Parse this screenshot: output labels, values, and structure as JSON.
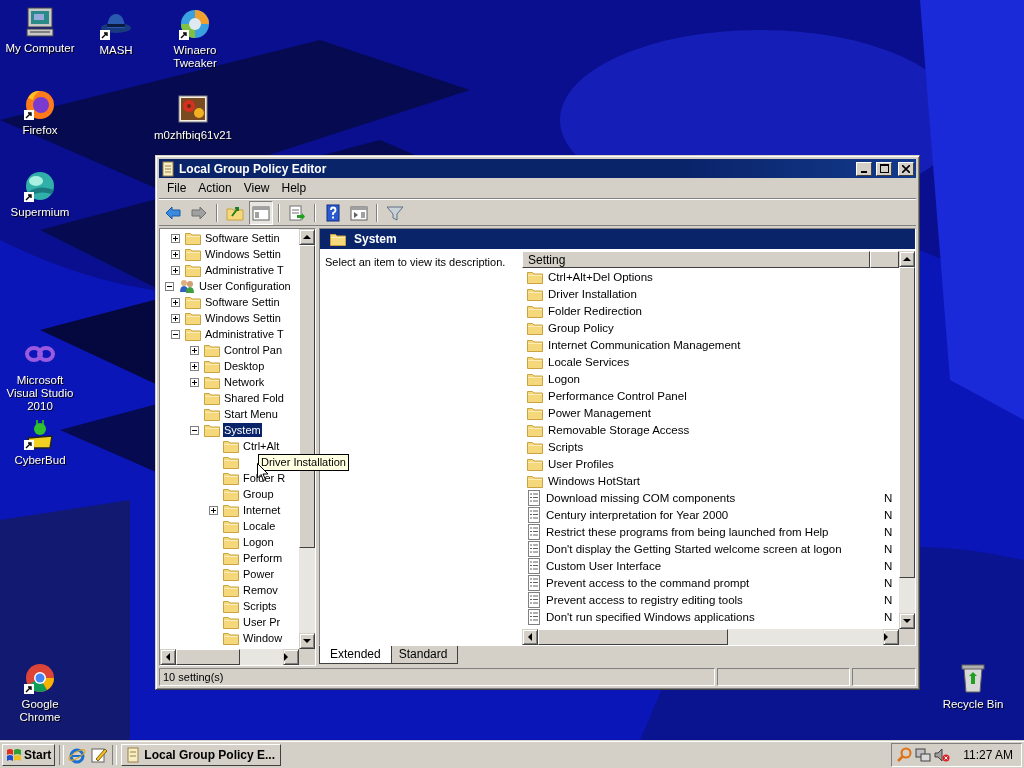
{
  "desktop_icons": [
    {
      "label": "My Computer",
      "shortcut": false
    },
    {
      "label": "MASH",
      "shortcut": true
    },
    {
      "label": "Winaero Tweaker",
      "shortcut": true
    },
    {
      "label": "Firefox",
      "shortcut": true
    },
    {
      "label": "m0zhfbiq61v21",
      "shortcut": false
    },
    {
      "label": "Supermium",
      "shortcut": true
    },
    {
      "label": "Microsoft Visual Studio 2010",
      "shortcut": false
    },
    {
      "label": "CyberBud",
      "shortcut": true
    },
    {
      "label": "Google Chrome",
      "shortcut": true
    },
    {
      "label": "Recycle Bin",
      "shortcut": false
    }
  ],
  "window": {
    "title": "Local Group Policy Editor",
    "menu": [
      "File",
      "Action",
      "View",
      "Help"
    ],
    "toolbar": [
      {
        "pressed": false
      },
      {
        "pressed": false
      },
      {
        "pressed": false
      },
      {
        "pressed": true
      },
      {
        "pressed": false
      },
      {
        "pressed": false
      },
      {
        "pressed": false
      },
      {
        "pressed": false
      }
    ],
    "tree": [
      {
        "children": [
          {
            "label": "Software Settin",
            "kind": "folder",
            "expanded": false,
            "selected": false
          },
          {
            "label": "Windows Settin",
            "kind": "folder",
            "expanded": false,
            "selected": false
          },
          {
            "label": "Administrative T",
            "kind": "folder",
            "expanded": false,
            "selected": false
          }
        ]
      },
      {
        "label": "User Configuration",
        "kind": "user",
        "expanded": true,
        "selected": false,
        "children": [
          {
            "label": "Software Settin",
            "kind": "folder",
            "expanded": false,
            "selected": false
          },
          {
            "label": "Windows Settin",
            "kind": "folder",
            "expanded": false,
            "selected": false
          },
          {
            "label": "Administrative T",
            "kind": "folder",
            "expanded": true,
            "selected": false,
            "children": [
              {
                "label": "Control Pan",
                "kind": "folder",
                "expanded": false,
                "selected": false
              },
              {
                "label": "Desktop",
                "kind": "folder",
                "expanded": false,
                "selected": false
              },
              {
                "label": "Network",
                "kind": "folder",
                "expanded": false,
                "selected": false
              },
              {
                "label": "Shared Fold",
                "kind": "folder",
                "selected": false
              },
              {
                "label": "Start Menu",
                "kind": "folder",
                "selected": false
              },
              {
                "label": "System",
                "kind": "folder",
                "expanded": true,
                "selected": true,
                "children": [
                  {
                    "label": "Ctrl+Alt",
                    "kind": "folder",
                    "selected": false
                  },
                  {
                    "kind": "folder",
                    "selected": false
                  },
                  {
                    "label": "Folder R",
                    "kind": "folder",
                    "selected": false
                  },
                  {
                    "label": "Group",
                    "kind": "folder",
                    "selected": false
                  },
                  {
                    "label": "Internet",
                    "kind": "folder",
                    "expanded": false,
                    "selected": false
                  },
                  {
                    "label": "Locale",
                    "kind": "folder",
                    "selected": false
                  },
                  {
                    "label": "Logon",
                    "kind": "folder",
                    "selected": false
                  },
                  {
                    "label": "Perform",
                    "kind": "folder",
                    "selected": false
                  },
                  {
                    "label": "Power",
                    "kind": "folder",
                    "selected": false
                  },
                  {
                    "label": "Remov",
                    "kind": "folder",
                    "selected": false
                  },
                  {
                    "label": "Scripts",
                    "kind": "folder",
                    "selected": false
                  },
                  {
                    "label": "User Pr",
                    "kind": "folder",
                    "selected": false
                  },
                  {
                    "label": "Window",
                    "kind": "folder",
                    "selected": false
                  }
                ]
              }
            ]
          }
        ]
      }
    ],
    "tooltip": "Driver Installation",
    "details": {
      "title": "System",
      "description": "Select an item to view its description.",
      "columns": [
        "Setting"
      ],
      "rows": [
        {
          "kind": "folder",
          "name": "Ctrl+Alt+Del Options"
        },
        {
          "kind": "folder",
          "name": "Driver Installation"
        },
        {
          "kind": "folder",
          "name": "Folder Redirection"
        },
        {
          "kind": "folder",
          "name": "Group Policy"
        },
        {
          "kind": "folder",
          "name": "Internet Communication Management"
        },
        {
          "kind": "folder",
          "name": "Locale Services"
        },
        {
          "kind": "folder",
          "name": "Logon"
        },
        {
          "kind": "folder",
          "name": "Performance Control Panel"
        },
        {
          "kind": "folder",
          "name": "Power Management"
        },
        {
          "kind": "folder",
          "name": "Removable Storage Access"
        },
        {
          "kind": "folder",
          "name": "Scripts"
        },
        {
          "kind": "folder",
          "name": "User Profiles"
        },
        {
          "kind": "folder",
          "name": "Windows HotStart"
        },
        {
          "kind": "setting",
          "name": "Download missing COM components",
          "column_2": "N"
        },
        {
          "kind": "setting",
          "name": "Century interpretation for Year 2000",
          "column_2": "N"
        },
        {
          "kind": "setting",
          "name": "Restrict these programs from being launched from Help",
          "column_2": "N"
        },
        {
          "kind": "setting",
          "name": "Don't display the Getting Started welcome screen at logon",
          "column_2": "N"
        },
        {
          "kind": "setting",
          "name": "Custom User Interface",
          "column_2": "N"
        },
        {
          "kind": "setting",
          "name": "Prevent access to the command prompt",
          "column_2": "N"
        },
        {
          "kind": "setting",
          "name": "Prevent access to registry editing tools",
          "column_2": "N"
        },
        {
          "kind": "setting",
          "name": "Don't run specified Windows applications",
          "column_2": "N"
        }
      ]
    },
    "tabs": [
      {
        "label": "Extended",
        "selected": true
      },
      {
        "label": "Standard",
        "selected": false
      }
    ],
    "status_bar": "10 setting(s)"
  },
  "taskbar": {
    "start": "Start",
    "task": "Local Group Policy E...",
    "clock": "11:27 AM"
  }
}
